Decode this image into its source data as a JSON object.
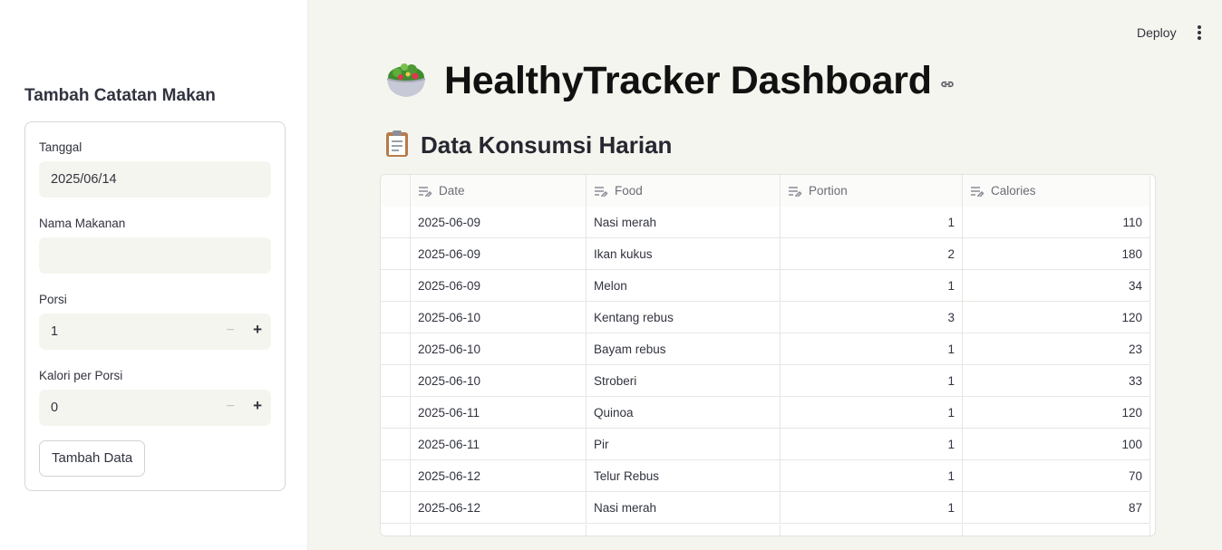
{
  "header": {
    "deploy_label": "Deploy",
    "menu_icon": "kebab-menu-icon"
  },
  "sidebar": {
    "title": "Tambah Catatan Makan",
    "fields": {
      "date": {
        "label": "Tanggal",
        "value": "2025/06/14"
      },
      "food_name": {
        "label": "Nama Makanan",
        "value": ""
      },
      "portion": {
        "label": "Porsi",
        "value": "1",
        "minus": "−",
        "plus": "+"
      },
      "calories": {
        "label": "Kalori per Porsi",
        "value": "0",
        "minus": "−",
        "plus": "+"
      }
    },
    "submit_label": "Tambah Data"
  },
  "main": {
    "title_icon": "salad-icon",
    "title": "HealthyTracker Dashboard",
    "section_icon": "clipboard-icon",
    "section_title": "Data Konsumsi Harian",
    "table": {
      "columns": [
        "Date",
        "Food",
        "Portion",
        "Calories"
      ],
      "rows": [
        [
          "2025-06-09",
          "Nasi merah",
          "1",
          "110"
        ],
        [
          "2025-06-09",
          "Ikan kukus",
          "2",
          "180"
        ],
        [
          "2025-06-09",
          "Melon",
          "1",
          "34"
        ],
        [
          "2025-06-10",
          "Kentang rebus",
          "3",
          "120"
        ],
        [
          "2025-06-10",
          "Bayam rebus",
          "1",
          "23"
        ],
        [
          "2025-06-10",
          "Stroberi",
          "1",
          "33"
        ],
        [
          "2025-06-11",
          "Quinoa",
          "1",
          "120"
        ],
        [
          "2025-06-11",
          "Pir",
          "1",
          "100"
        ],
        [
          "2025-06-12",
          "Telur Rebus",
          "1",
          "70"
        ],
        [
          "2025-06-12",
          "Nasi merah",
          "1",
          "87"
        ]
      ]
    }
  }
}
